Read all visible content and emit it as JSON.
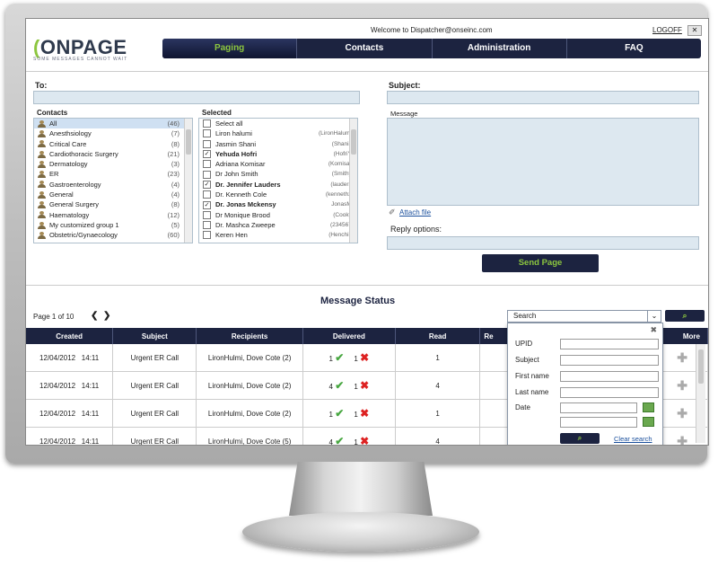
{
  "header": {
    "welcome_text": "Welcome to Dispatcher@onseinc.com",
    "logoff_label": "LOGOFF",
    "close_label": "✕",
    "logo_text_a": "(",
    "logo_text_b": "ONPAGE",
    "logo_tagline": "SOME MESSAGES CANNOT WAIT"
  },
  "nav": {
    "items": [
      "Paging",
      "Contacts",
      "Administration",
      "FAQ"
    ],
    "active": "Paging"
  },
  "compose": {
    "to_label": "To:",
    "subject_label": "Subject:",
    "contacts_header": "Contacts",
    "selected_header": "Selected",
    "message_label": "Message",
    "attach_label": "Attach file",
    "reply_label": "Reply options:",
    "send_label": "Send Page"
  },
  "contacts": [
    {
      "name": "All",
      "count": "(46)",
      "selected": true
    },
    {
      "name": "Anesthsiology",
      "count": "(7)"
    },
    {
      "name": "Critical Care",
      "count": "(8)"
    },
    {
      "name": "Cardiothoracic Surgery",
      "count": "(21)"
    },
    {
      "name": "Dermatology",
      "count": "(3)"
    },
    {
      "name": "ER",
      "count": "(23)"
    },
    {
      "name": "Gastroenterology",
      "count": "(4)"
    },
    {
      "name": "General",
      "count": "(4)"
    },
    {
      "name": "General Surgery",
      "count": "(8)"
    },
    {
      "name": "Haematology",
      "count": "(12)"
    },
    {
      "name": "My customized group 1",
      "count": "(5)"
    },
    {
      "name": "Obstetric/Gynaecology",
      "count": "(60)"
    }
  ],
  "selected_list": [
    {
      "name": "Select all",
      "nick": "",
      "checked": false,
      "bold": false
    },
    {
      "name": "Liron halumi",
      "nick": "(LironHalumi)",
      "checked": false,
      "bold": false
    },
    {
      "name": "Jasmin Shani",
      "nick": "(ShaniJ)",
      "checked": false,
      "bold": false
    },
    {
      "name": "Yehuda Hofri",
      "nick": "(HofriY)",
      "checked": true,
      "bold": true
    },
    {
      "name": "Adriana Komisar",
      "nick": "(Komisar)",
      "checked": false,
      "bold": false
    },
    {
      "name": "Dr John Smith",
      "nick": "(Smithy)",
      "checked": false,
      "bold": false
    },
    {
      "name": "Dr. Jennifer Lauders",
      "nick": "(lauders)",
      "checked": true,
      "bold": true
    },
    {
      "name": "Dr. Kenneth Cole",
      "nick": "(kenneth2)",
      "checked": false,
      "bold": false
    },
    {
      "name": "Dr. Jonas Mckensy",
      "nick": "JonasM)",
      "checked": true,
      "bold": true
    },
    {
      "name": "Dr Monique Brood",
      "nick": "(Cooky)",
      "checked": false,
      "bold": false
    },
    {
      "name": "Dr. Mashca Zweepe",
      "nick": "(234567)",
      "checked": false,
      "bold": false
    },
    {
      "name": "Keren Hen",
      "nick": "(Henchik)",
      "checked": false,
      "bold": false
    }
  ],
  "status": {
    "title": "Message Status",
    "page_text": "Page 1 of 10",
    "prev": "❮",
    "next": "❯",
    "search_label": "Search",
    "columns": [
      "Created",
      "Subject",
      "Recipients",
      "Delivered",
      "Read",
      "Re",
      "More"
    ],
    "rows": [
      {
        "date": "12/04/2012",
        "time": "14:11",
        "subject": "Urgent ER Call",
        "recipients": "LironHulmi, Dove Cote (2)",
        "delivered_ok": "1",
        "delivered_fail": "1",
        "read": "1"
      },
      {
        "date": "12/04/2012",
        "time": "14:11",
        "subject": "Urgent ER Call",
        "recipients": "LironHulmi, Dove Cote (2)",
        "delivered_ok": "4",
        "delivered_fail": "1",
        "read": "4"
      },
      {
        "date": "12/04/2012",
        "time": "14:11",
        "subject": "Urgent ER Call",
        "recipients": "LironHulmi, Dove Cote (2)",
        "delivered_ok": "1",
        "delivered_fail": "1",
        "read": "1"
      },
      {
        "date": "12/04/2012",
        "time": "14:11",
        "subject": "Urgent ER Call",
        "recipients": "LironHulmi, Dove Cote (5)",
        "delivered_ok": "4",
        "delivered_fail": "1",
        "read": "4"
      }
    ]
  },
  "search_panel": {
    "fields": [
      "UPID",
      "Subject",
      "First name",
      "Last name",
      "Date"
    ],
    "clear_label": "Clear search"
  },
  "icons": {
    "check": "✔",
    "cross": "✖",
    "plus": "✚",
    "clip": "📎",
    "magnifier": "🔍"
  },
  "colors": {
    "nav_bg": "#1c2340",
    "accent_green": "#8cc63f",
    "field_bg": "#dde8f0"
  }
}
